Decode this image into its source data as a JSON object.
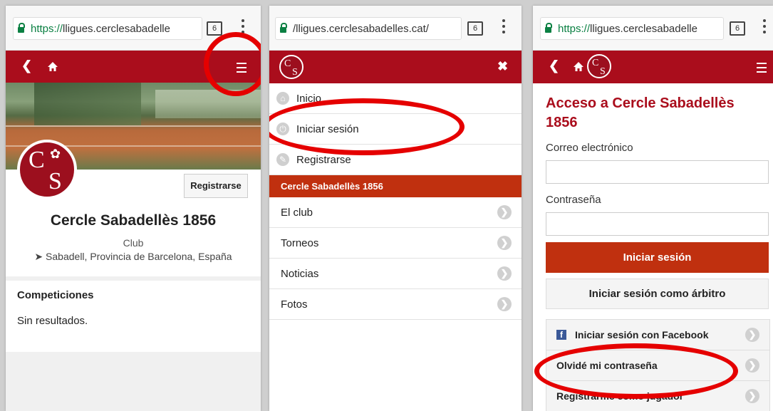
{
  "panel1": {
    "url": {
      "https": "https://",
      "rest": "lligues.cerclesabadelle"
    },
    "tab_count": "6",
    "club_name": "Cercle Sabadellès 1856",
    "club_type": "Club",
    "location": "Sabadell, Provincia de Barcelona, España",
    "register_label": "Registrarse",
    "logo_c": "C",
    "logo_s": "S",
    "competitions_title": "Competiciones",
    "no_results": "Sin resultados."
  },
  "panel2": {
    "url": {
      "text": "/lligues.cerclesabadelles.cat/"
    },
    "tab_count": "6",
    "logo_c": "C",
    "logo_s": "S",
    "close": "✖",
    "menu_top": [
      {
        "label": "Inicio"
      },
      {
        "label": "Iniciar sesión"
      },
      {
        "label": "Registrarse"
      }
    ],
    "section_header": "Cercle Sabadellès 1856",
    "menu_club": [
      {
        "label": "El club"
      },
      {
        "label": "Torneos"
      },
      {
        "label": "Noticias"
      },
      {
        "label": "Fotos"
      }
    ]
  },
  "panel3": {
    "url": {
      "https": "https://",
      "rest": "lligues.cerclesabadelle"
    },
    "tab_count": "6",
    "logo_c": "C",
    "logo_s": "S",
    "title": "Acceso a Cercle Sabadellès 1856",
    "email_label": "Correo electrónico",
    "password_label": "Contraseña",
    "login_button": "Iniciar sesión",
    "referee_button": "Iniciar sesión como árbitro",
    "facebook_label": "Iniciar sesión con Facebook",
    "forgot_label": "Olvidé mi contraseña",
    "register_player_label": "Registrarme como jugador"
  },
  "colors": {
    "brand_red": "#aa0d1c",
    "accent_orange": "#c0300f",
    "annotation_red": "#e50000"
  },
  "icons": [
    "lock-icon",
    "back-icon",
    "home-icon",
    "hamburger-icon",
    "close-icon",
    "chevron-right-icon",
    "facebook-icon",
    "location-arrow-icon"
  ]
}
